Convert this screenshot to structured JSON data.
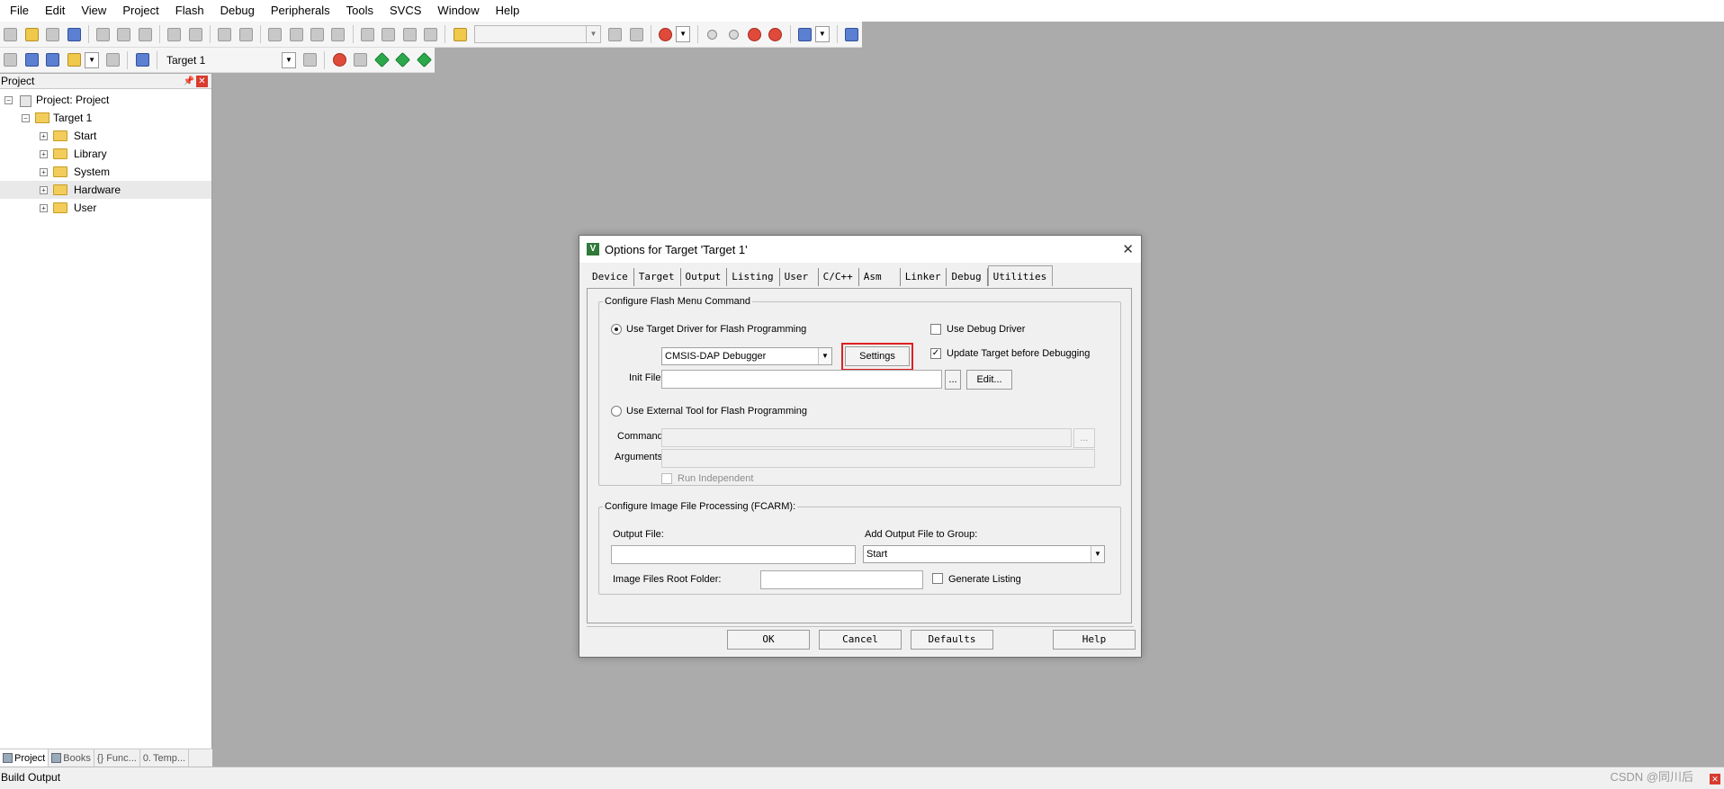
{
  "menu": [
    "File",
    "Edit",
    "View",
    "Project",
    "Flash",
    "Debug",
    "Peripherals",
    "Tools",
    "SVCS",
    "Window",
    "Help"
  ],
  "toolbar2": {
    "target": "Target 1"
  },
  "project_panel": {
    "title": "Project",
    "root": "Project: Project",
    "target": "Target 1",
    "groups": [
      "Start",
      "Library",
      "System",
      "Hardware",
      "User"
    ],
    "selected_group": "Hardware",
    "tabs": [
      "Project",
      "Books",
      "Func...",
      "Temp..."
    ]
  },
  "build_output": "Build Output",
  "watermark": "CSDN @同川后",
  "dialog": {
    "title": "Options for Target 'Target 1'",
    "tabs": [
      "Device",
      "Target",
      "Output",
      "Listing",
      "User",
      "C/C++",
      "Asm",
      "Linker",
      "Debug",
      "Utilities"
    ],
    "active_tab": "Utilities",
    "flash_group": {
      "legend": "Configure Flash Menu Command",
      "use_target_driver": "Use Target Driver for Flash Programming",
      "driver_value": "CMSIS-DAP Debugger",
      "settings_button": "Settings",
      "use_debug_driver": "Use Debug Driver",
      "update_target": "Update Target before Debugging",
      "init_file_label": "Init File:",
      "init_file_value": "",
      "browse_button": "...",
      "edit_button": "Edit...",
      "use_external_tool": "Use External Tool for Flash Programming",
      "command_label": "Command:",
      "command_browse": "...",
      "arguments_label": "Arguments:",
      "run_independent": "Run Independent"
    },
    "image_group": {
      "legend": "Configure Image File Processing (FCARM):",
      "output_file_label": "Output File:",
      "output_file_value": "",
      "add_output_label": "Add Output File  to Group:",
      "add_output_value": "Start",
      "root_folder_label": "Image Files Root Folder:",
      "root_folder_value": "",
      "generate_listing": "Generate Listing"
    },
    "buttons": {
      "ok": "OK",
      "cancel": "Cancel",
      "defaults": "Defaults",
      "help": "Help"
    }
  }
}
